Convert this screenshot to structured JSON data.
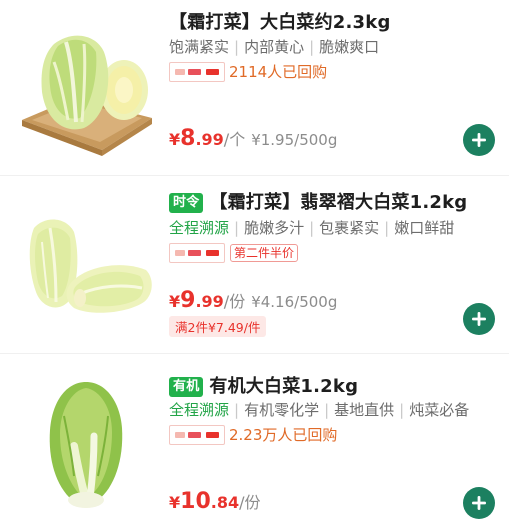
{
  "colors": {
    "accent_green": "#1c8060",
    "price_red": "#e8322c",
    "social_orange": "#e06a27",
    "badge_green": "#22b14c"
  },
  "products": [
    {
      "title": "【霜打菜】大白菜约2.3kg",
      "tags": [
        "饱满紧实",
        "内部黄心",
        "脆嫩爽口"
      ],
      "social_text": "2114人已回购",
      "price_symbol": "¥",
      "price_int": "8",
      "price_dec": ".99",
      "price_unit": "/个",
      "unit_price": "¥1.95/500g",
      "image_icon": "napa-cabbage-on-board-icon",
      "add_icon": "plus-icon"
    },
    {
      "badge": "时令",
      "title": "【霜打菜】翡翠褶大白菜1.2kg",
      "source_tag": "全程溯源",
      "tags": [
        "脆嫩多汁",
        "包裹紧实",
        "嫩口鲜甜"
      ],
      "promo": "第二件半价",
      "price_symbol": "¥",
      "price_int": "9",
      "price_dec": ".99",
      "price_unit": "/份",
      "unit_price": "¥4.16/500g",
      "deal": "满2件¥7.49/件",
      "image_icon": "two-napa-cabbages-icon",
      "add_icon": "plus-icon"
    },
    {
      "badge": "有机",
      "title": "有机大白菜1.2kg",
      "source_tag": "全程溯源",
      "tags": [
        "有机零化学",
        "基地直供",
        "炖菜必备"
      ],
      "social_text": "2.23万人已回购",
      "price_symbol": "¥",
      "price_int": "10",
      "price_dec": ".84",
      "price_unit": "/份",
      "image_icon": "upright-napa-cabbage-icon",
      "add_icon": "plus-icon"
    }
  ]
}
